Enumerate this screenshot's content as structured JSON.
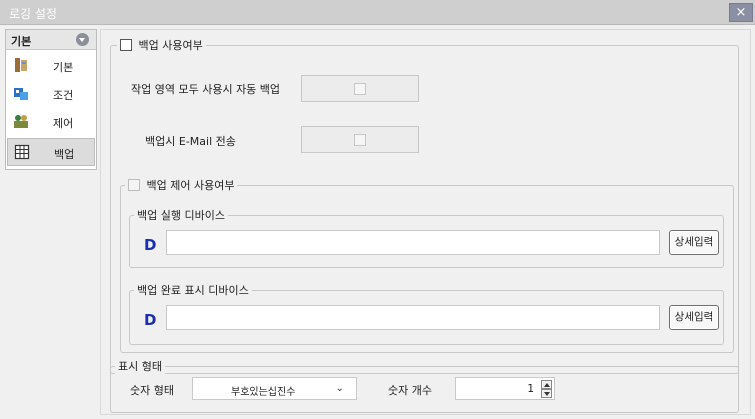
{
  "window": {
    "title": "로깅 설정",
    "close": "×"
  },
  "sidebar": {
    "header": "기본",
    "items": [
      {
        "label": "기본",
        "icon": "basic-config-icon"
      },
      {
        "label": "조건",
        "icon": "condition-icon"
      },
      {
        "label": "제어",
        "icon": "control-icon"
      },
      {
        "label": "백업",
        "icon": "backup-grid-icon",
        "selected": true
      }
    ]
  },
  "backup": {
    "use_label": "백업 사용여부",
    "use_checked": false,
    "auto_backup_label": "작업 영역 모두 사용시 자동 백업",
    "email_label": "백업시 E-Mail 전송",
    "control": {
      "use_label": "백업 제어 사용여부",
      "exec_device": {
        "title": "백업 실행 디바이스",
        "prefix": "D",
        "value": "",
        "button": "상세입력"
      },
      "done_device": {
        "title": "백업 완료 표시 디바이스",
        "prefix": "D",
        "value": "",
        "button": "상세입력"
      }
    }
  },
  "display": {
    "title": "표시 형태",
    "format_label": "숫자 형태",
    "format_value": "부호있는십진수",
    "count_label": "숫자 개수",
    "count_value": "1"
  },
  "colors": {
    "device_letter": "#1a2fb0",
    "titlebar": "#cfcfcf",
    "close_button": "#8a8fa3"
  }
}
